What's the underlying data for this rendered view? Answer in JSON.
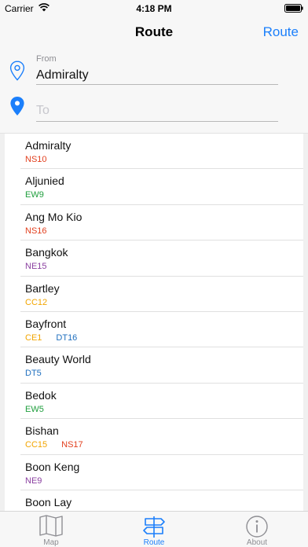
{
  "status_bar": {
    "carrier": "Carrier",
    "time": "4:18 PM"
  },
  "nav": {
    "title": "Route",
    "action_label": "Route"
  },
  "route": {
    "from_label": "From",
    "from_value": "Admiralty",
    "to_placeholder": "To",
    "to_value": ""
  },
  "colors": {
    "accent": "#1b7ffb",
    "NS": "#e2401f",
    "EW": "#1f9e3d",
    "NE": "#8a3fa0",
    "CC": "#f2a500",
    "DT": "#1f6fbf"
  },
  "stations": [
    {
      "name": "Admiralty",
      "codes": [
        {
          "text": "NS10",
          "line": "NS"
        }
      ]
    },
    {
      "name": "Aljunied",
      "codes": [
        {
          "text": "EW9",
          "line": "EW"
        }
      ]
    },
    {
      "name": "Ang Mo Kio",
      "codes": [
        {
          "text": "NS16",
          "line": "NS"
        }
      ]
    },
    {
      "name": "Bangkok",
      "codes": [
        {
          "text": "NE15",
          "line": "NE"
        }
      ]
    },
    {
      "name": "Bartley",
      "codes": [
        {
          "text": "CC12",
          "line": "CC"
        }
      ]
    },
    {
      "name": "Bayfront",
      "codes": [
        {
          "text": "CE1",
          "line": "CC"
        },
        {
          "text": "DT16",
          "line": "DT"
        }
      ]
    },
    {
      "name": "Beauty World",
      "codes": [
        {
          "text": "DT5",
          "line": "DT"
        }
      ]
    },
    {
      "name": "Bedok",
      "codes": [
        {
          "text": "EW5",
          "line": "EW"
        }
      ]
    },
    {
      "name": "Bishan",
      "codes": [
        {
          "text": "CC15",
          "line": "CC"
        },
        {
          "text": "NS17",
          "line": "NS"
        }
      ]
    },
    {
      "name": "Boon Keng",
      "codes": [
        {
          "text": "NE9",
          "line": "NE"
        }
      ]
    },
    {
      "name": "Boon Lay",
      "codes": [
        {
          "text": "",
          "line": "EW"
        }
      ]
    }
  ],
  "tabs": [
    {
      "label": "Map",
      "icon": "map-icon",
      "active": false
    },
    {
      "label": "Route",
      "icon": "signpost-icon",
      "active": true
    },
    {
      "label": "About",
      "icon": "info-icon",
      "active": false
    }
  ]
}
